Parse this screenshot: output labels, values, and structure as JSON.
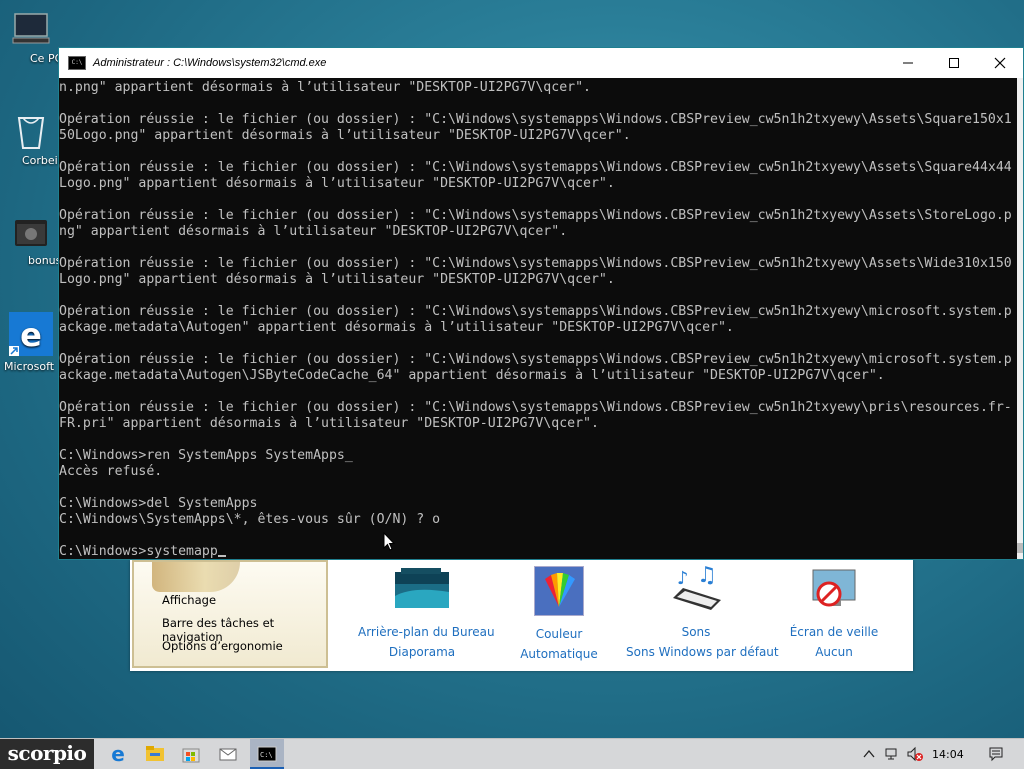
{
  "desktop": {
    "icons": [
      {
        "name": "this-pc",
        "label": "Ce PC"
      },
      {
        "name": "recycle-bin",
        "label": "Corbeille"
      },
      {
        "name": "bonus-folder",
        "label": "bonus"
      },
      {
        "name": "edge",
        "label": "Microsoft"
      }
    ]
  },
  "cmd": {
    "title": "Administrateur : C:\\Windows\\system32\\cmd.exe",
    "lines": [
      "n.png\" appartient désormais à l’utilisateur \"DESKTOP-UI2PG7V\\qcer\".",
      "",
      "Opération réussie : le fichier (ou dossier) : \"C:\\Windows\\systemapps\\Windows.CBSPreview_cw5n1h2txyewy\\Assets\\Square150x1",
      "50Logo.png\" appartient désormais à l’utilisateur \"DESKTOP-UI2PG7V\\qcer\".",
      "",
      "Opération réussie : le fichier (ou dossier) : \"C:\\Windows\\systemapps\\Windows.CBSPreview_cw5n1h2txyewy\\Assets\\Square44x44",
      "Logo.png\" appartient désormais à l’utilisateur \"DESKTOP-UI2PG7V\\qcer\".",
      "",
      "Opération réussie : le fichier (ou dossier) : \"C:\\Windows\\systemapps\\Windows.CBSPreview_cw5n1h2txyewy\\Assets\\StoreLogo.p",
      "ng\" appartient désormais à l’utilisateur \"DESKTOP-UI2PG7V\\qcer\".",
      "",
      "Opération réussie : le fichier (ou dossier) : \"C:\\Windows\\systemapps\\Windows.CBSPreview_cw5n1h2txyewy\\Assets\\Wide310x150",
      "Logo.png\" appartient désormais à l’utilisateur \"DESKTOP-UI2PG7V\\qcer\".",
      "",
      "Opération réussie : le fichier (ou dossier) : \"C:\\Windows\\systemapps\\Windows.CBSPreview_cw5n1h2txyewy\\microsoft.system.p",
      "ackage.metadata\\Autogen\" appartient désormais à l’utilisateur \"DESKTOP-UI2PG7V\\qcer\".",
      "",
      "Opération réussie : le fichier (ou dossier) : \"C:\\Windows\\systemapps\\Windows.CBSPreview_cw5n1h2txyewy\\microsoft.system.p",
      "ackage.metadata\\Autogen\\JSByteCodeCache_64\" appartient désormais à l’utilisateur \"DESKTOP-UI2PG7V\\qcer\".",
      "",
      "Opération réussie : le fichier (ou dossier) : \"C:\\Windows\\systemapps\\Windows.CBSPreview_cw5n1h2txyewy\\pris\\resources.fr-",
      "FR.pri\" appartient désormais à l’utilisateur \"DESKTOP-UI2PG7V\\qcer\".",
      "",
      "C:\\Windows>ren SystemApps SystemApps_",
      "Accès refusé.",
      "",
      "C:\\Windows>del SystemApps",
      "C:\\Windows\\SystemApps\\*, êtes-vous sûr (O/N) ? o",
      ""
    ],
    "prompt_line": "C:\\Windows>systemapp"
  },
  "personalization": {
    "links": [
      "Affichage",
      "Barre des tâches et navigation",
      "Options d’ergonomie"
    ],
    "items": [
      {
        "name": "desktop-background",
        "title": "Arrière-plan du Bureau",
        "value": "Diaporama"
      },
      {
        "name": "color",
        "title": "Couleur",
        "value": "Automatique"
      },
      {
        "name": "sounds",
        "title": "Sons",
        "value": "Sons Windows par défaut"
      },
      {
        "name": "screensaver",
        "title": "Écran de veille",
        "value": "Aucun"
      }
    ]
  },
  "taskbar": {
    "start_label": "scorpio",
    "clock": "14:04"
  },
  "colors": {
    "console_bg": "#0c0c0c",
    "console_fg": "#c0c0c0",
    "link_blue": "#1f6fbf",
    "taskbar": "#d6d7d9"
  }
}
